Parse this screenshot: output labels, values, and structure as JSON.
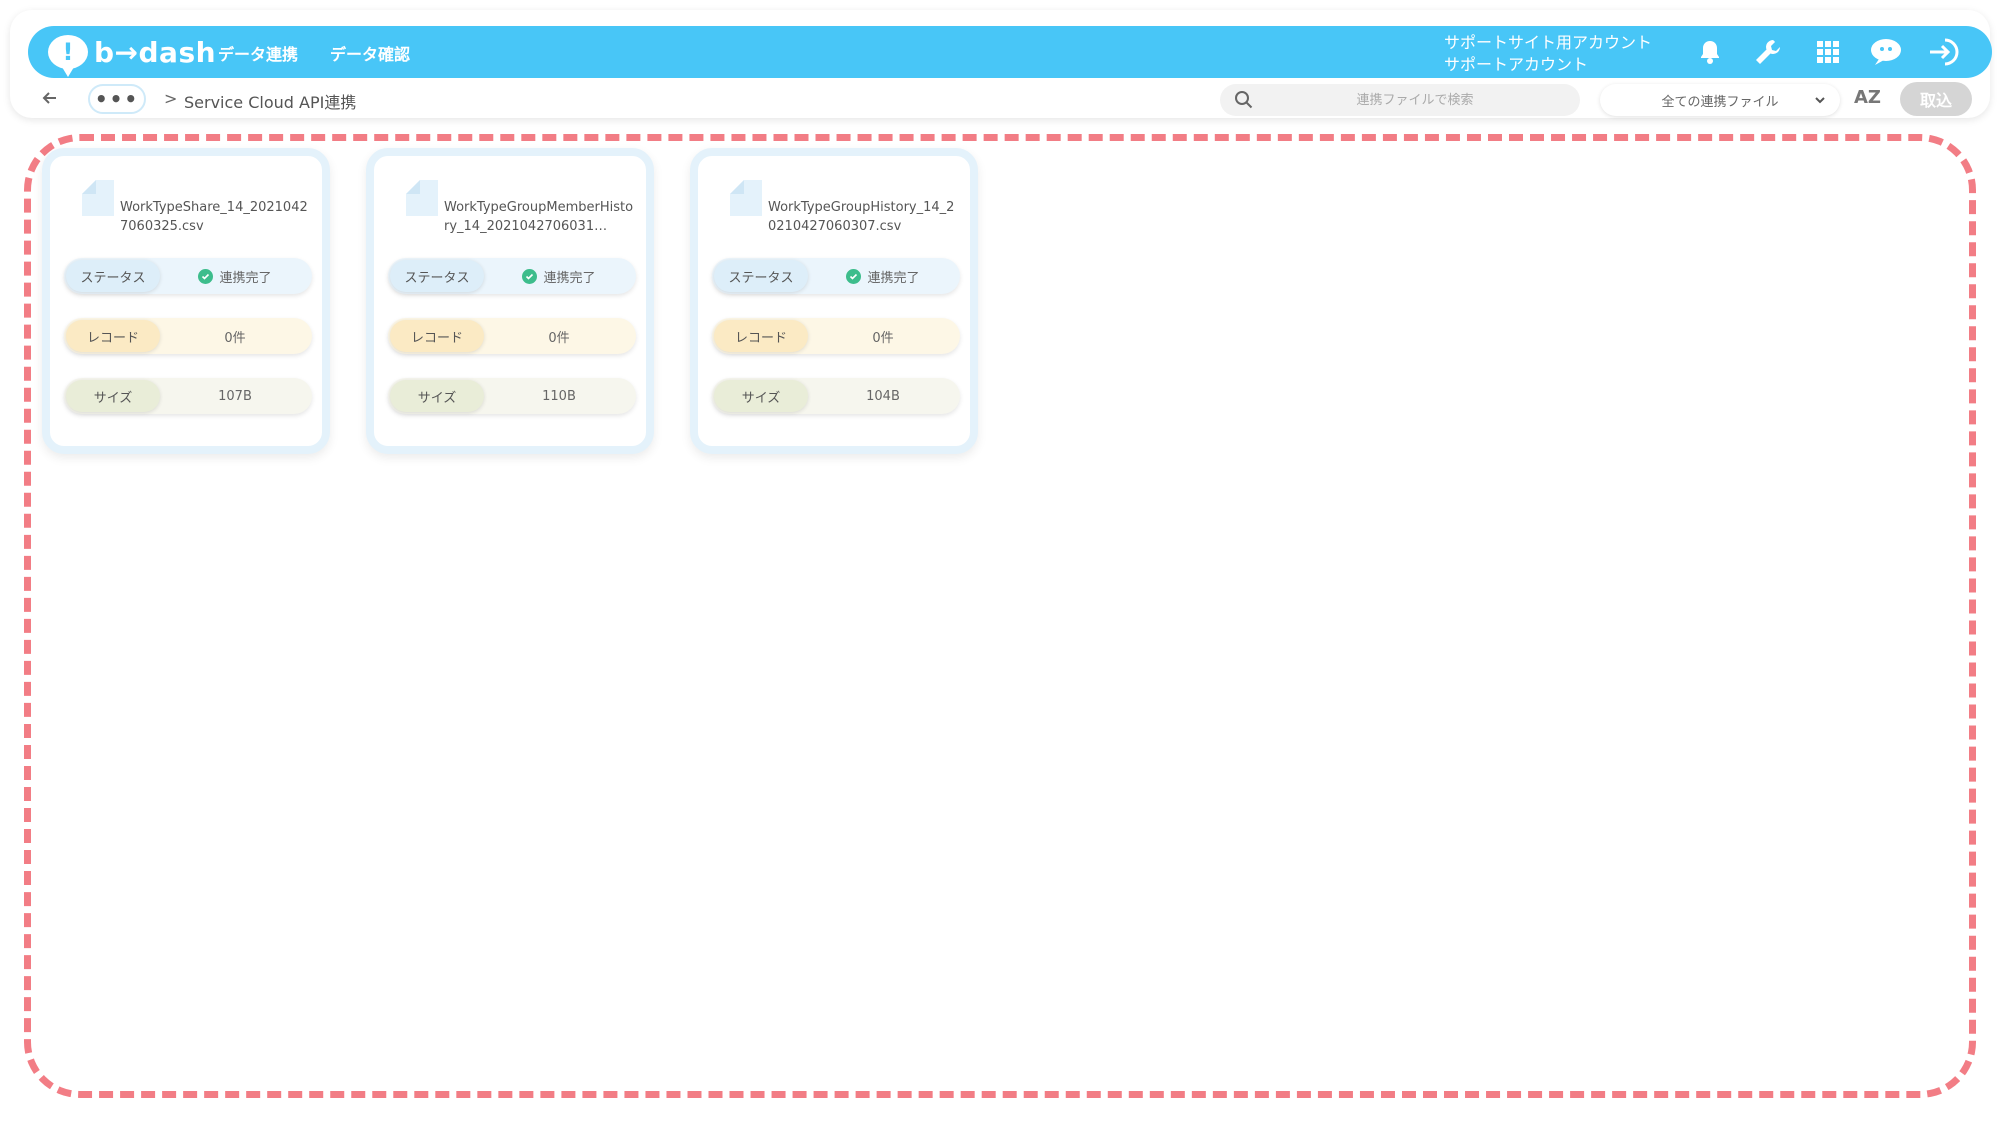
{
  "header": {
    "logo_text": "b→dash",
    "nav": [
      "データ連携",
      "データ確認"
    ],
    "account_line1": "サポートサイト用アカウント",
    "account_line2": "サポートアカウント",
    "icons": [
      "bell-icon",
      "wrench-icon",
      "grid-icon",
      "chat-icon",
      "logout-icon"
    ]
  },
  "subbar": {
    "more_label": "•••",
    "separator": ">",
    "breadcrumb_title": "Service Cloud API連携",
    "search_placeholder": "連携ファイルで検索",
    "filter_selected": "全ての連携ファイル",
    "sort_label": "AZ",
    "import_label": "取込"
  },
  "cards": [
    {
      "file_name": "WorkTypeShare_14_20210427060325.csv",
      "status_label": "ステータス",
      "status_value": "連携完了",
      "record_label": "レコード",
      "record_value": "0件",
      "size_label": "サイズ",
      "size_value": "107B"
    },
    {
      "file_name": "WorkTypeGroupMemberHistory_14_2021042706031…",
      "status_label": "ステータス",
      "status_value": "連携完了",
      "record_label": "レコード",
      "record_value": "0件",
      "size_label": "サイズ",
      "size_value": "110B"
    },
    {
      "file_name": "WorkTypeGroupHistory_14_20210427060307.csv",
      "status_label": "ステータス",
      "status_value": "連携完了",
      "record_label": "レコード",
      "record_value": "0件",
      "size_label": "サイズ",
      "size_value": "104B"
    }
  ],
  "colors": {
    "header_blue": "#48c6f7",
    "dashed_border": "#f27d85",
    "status_ok": "#3dbd8c",
    "import_disabled": "#d5d5d5"
  }
}
